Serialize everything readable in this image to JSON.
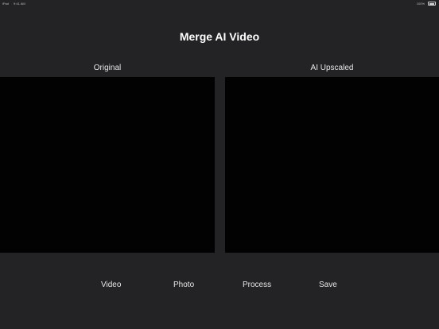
{
  "status_bar": {
    "carrier": "iPad",
    "time": "9:41 AM",
    "battery_label": "100%"
  },
  "app": {
    "title": "Merge AI Video"
  },
  "panels": {
    "original_label": "Original",
    "upscaled_label": "AI Upscaled"
  },
  "toolbar": {
    "video_label": "Video",
    "photo_label": "Photo",
    "process_label": "Process",
    "save_label": "Save"
  },
  "colors": {
    "background": "#232325",
    "panel": "#020202",
    "text": "#ffffff"
  }
}
